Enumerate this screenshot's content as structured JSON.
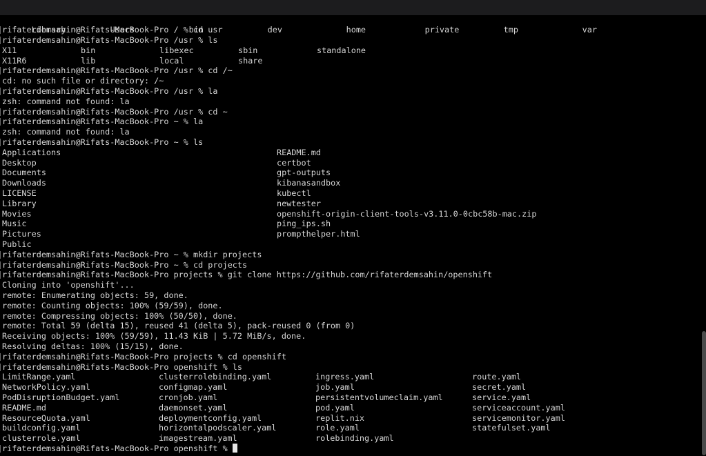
{
  "terminal": {
    "prompt_user_host": "rifaterdemsahin@Rifats-MacBook-Pro",
    "root_listing": [
      "Library",
      "Users",
      "bin",
      "dev",
      "home",
      "private",
      "tmp",
      "var"
    ],
    "lines": [
      {
        "type": "prompt",
        "text": "rifaterdemsahin@Rifats-MacBook-Pro / % cd usr"
      },
      {
        "type": "prompt",
        "text": "rifaterdemsahin@Rifats-MacBook-Pro /usr % ls"
      },
      {
        "type": "cols",
        "width": 114,
        "cells": [
          "X11",
          "bin",
          "libexec",
          "sbin",
          "standalone"
        ]
      },
      {
        "type": "cols",
        "width": 114,
        "cells": [
          "X11R6",
          "lib",
          "local",
          "share"
        ]
      },
      {
        "type": "prompt",
        "text": "rifaterdemsahin@Rifats-MacBook-Pro /usr % cd /~"
      },
      {
        "type": "text",
        "text": "cd: no such file or directory: /~"
      },
      {
        "type": "prompt",
        "text": "rifaterdemsahin@Rifats-MacBook-Pro /usr % la"
      },
      {
        "type": "text",
        "text": "zsh: command not found: la"
      },
      {
        "type": "prompt",
        "text": "rifaterdemsahin@Rifats-MacBook-Pro /usr % cd ~"
      },
      {
        "type": "prompt",
        "text": "rifaterdemsahin@Rifats-MacBook-Pro ~ % la"
      },
      {
        "type": "text",
        "text": "zsh: command not found: la"
      },
      {
        "type": "prompt",
        "text": "rifaterdemsahin@Rifats-MacBook-Pro ~ % ls"
      },
      {
        "type": "cols",
        "width": 398,
        "cells": [
          "Applications",
          "README.md"
        ]
      },
      {
        "type": "cols",
        "width": 398,
        "cells": [
          "Desktop",
          "certbot"
        ]
      },
      {
        "type": "cols",
        "width": 398,
        "cells": [
          "Documents",
          "gpt-outputs"
        ]
      },
      {
        "type": "cols",
        "width": 398,
        "cells": [
          "Downloads",
          "kibanasandbox"
        ]
      },
      {
        "type": "cols",
        "width": 398,
        "cells": [
          "LICENSE",
          "kubectl"
        ]
      },
      {
        "type": "cols",
        "width": 398,
        "cells": [
          "Library",
          "newtester"
        ]
      },
      {
        "type": "cols",
        "width": 398,
        "cells": [
          "Movies",
          "openshift-origin-client-tools-v3.11.0-0cbc58b-mac.zip"
        ]
      },
      {
        "type": "cols",
        "width": 398,
        "cells": [
          "Music",
          "ping_ips.sh"
        ]
      },
      {
        "type": "cols",
        "width": 398,
        "cells": [
          "Pictures",
          "prompthelper.html"
        ]
      },
      {
        "type": "cols",
        "width": 398,
        "cells": [
          "Public"
        ]
      },
      {
        "type": "prompt",
        "text": "rifaterdemsahin@Rifats-MacBook-Pro ~ % mkdir projects"
      },
      {
        "type": "prompt",
        "text": "rifaterdemsahin@Rifats-MacBook-Pro ~ % cd projects"
      },
      {
        "type": "prompt",
        "text": "rifaterdemsahin@Rifats-MacBook-Pro projects % git clone https://github.com/rifaterdemsahin/openshift"
      },
      {
        "type": "text",
        "text": "Cloning into 'openshift'..."
      },
      {
        "type": "text",
        "text": "remote: Enumerating objects: 59, done."
      },
      {
        "type": "text",
        "text": "remote: Counting objects: 100% (59/59), done."
      },
      {
        "type": "text",
        "text": "remote: Compressing objects: 100% (50/50), done."
      },
      {
        "type": "text",
        "text": "remote: Total 59 (delta 15), reused 41 (delta 5), pack-reused 0 (from 0)"
      },
      {
        "type": "text",
        "text": "Receiving objects: 100% (59/59), 11.43 KiB | 5.72 MiB/s, done."
      },
      {
        "type": "text",
        "text": "Resolving deltas: 100% (15/15), done."
      },
      {
        "type": "prompt",
        "text": "rifaterdemsahin@Rifats-MacBook-Pro projects % cd openshift"
      },
      {
        "type": "prompt",
        "text": "rifaterdemsahin@Rifats-MacBook-Pro openshift % ls"
      },
      {
        "type": "cols",
        "width": 227,
        "cells": [
          "LimitRange.yaml",
          "clusterrolebinding.yaml",
          "ingress.yaml",
          "route.yaml"
        ]
      },
      {
        "type": "cols",
        "width": 227,
        "cells": [
          "NetworkPolicy.yaml",
          "configmap.yaml",
          "job.yaml",
          "secret.yaml"
        ]
      },
      {
        "type": "cols",
        "width": 227,
        "cells": [
          "PodDisruptionBudget.yaml",
          "cronjob.yaml",
          "persistentvolumeclaim.yaml",
          "service.yaml"
        ]
      },
      {
        "type": "cols",
        "width": 227,
        "cells": [
          "README.md",
          "daemonset.yaml",
          "pod.yaml",
          "serviceaccount.yaml"
        ]
      },
      {
        "type": "cols",
        "width": 227,
        "cells": [
          "ResourceQuota.yaml",
          "deploymentconfig.yaml",
          "replit.nix",
          "servicemonitor.yaml"
        ]
      },
      {
        "type": "cols",
        "width": 227,
        "cells": [
          "buildconfig.yaml",
          "horizontalpodscaler.yaml",
          "role.yaml",
          "statefulset.yaml"
        ]
      },
      {
        "type": "cols",
        "width": 227,
        "cells": [
          "clusterrole.yaml",
          "imagestream.yaml",
          "rolebinding.yaml"
        ]
      },
      {
        "type": "input",
        "text": "rifaterdemsahin@Rifats-MacBook-Pro openshift % "
      }
    ]
  },
  "colors": {
    "background": "#000000",
    "text": "#d7d7d7",
    "cursor": "#e6e6e6",
    "scrollbar": "#4b4b4b"
  }
}
